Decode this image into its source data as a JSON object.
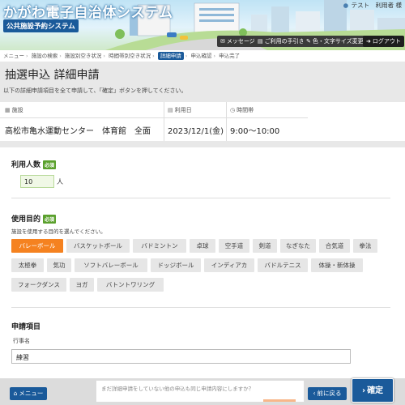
{
  "header": {
    "title": "かがわ電子自治体システム",
    "subtitle": "公共施設予約システム",
    "user_name": "テスト　利用者 様",
    "buttons": [
      {
        "icon": "message-icon",
        "label": "メッセージ"
      },
      {
        "icon": "guide-icon",
        "label": "ご利用の手引き"
      },
      {
        "icon": "paint-icon",
        "label": "色・文字サイズ変更"
      },
      {
        "icon": "logout-icon",
        "label": "ログアウト"
      }
    ]
  },
  "breadcrumb": {
    "items": [
      "メニュー",
      "施設の検索",
      "施設別空き状況",
      "時間帯別空き状況",
      "詳細申請",
      "申込確認",
      "申込完了"
    ],
    "current_index": 4
  },
  "page": {
    "title": "抽選申込 詳細申請",
    "instruction": "以下の詳細申請項目を全て申請して、「確定」ボタンを押してください。"
  },
  "facility": {
    "facility_label": "施設",
    "facility_value": "高松市亀水運動センター　体育館　全面",
    "date_label": "利用日",
    "date_value": "2023/12/1(金)",
    "time_label": "時間帯",
    "time_value": "9:00～10:00"
  },
  "form": {
    "count_title": "利用人数",
    "required_label": "必須",
    "count_value": "10",
    "count_unit": "人",
    "purpose_title": "使用目的",
    "purpose_hint": "施設を使用する目的を選んでください。",
    "purposes": [
      "バレーボール",
      "バスケットボール",
      "バドミントン",
      "卓球",
      "空手道",
      "剣道",
      "なぎなた",
      "合気道",
      "拳法",
      "太極拳",
      "気功",
      "ソフトバレーボール",
      "ドッジボール",
      "インディアカ",
      "バドルテニス",
      "体操・新体操",
      "フォークダンス",
      "ヨガ",
      "バトントワリング"
    ],
    "selected_purpose": "バレーボール",
    "application_title": "申請項目",
    "event_name_label": "行事名",
    "event_name_value": "練習"
  },
  "footer": {
    "menu_label": "メニュー",
    "back_label": "前に戻る",
    "confirm_label": "確定",
    "dialog_hint": "まだ詳細申請をしていない他の申込も同じ申請内容にしますか？"
  },
  "colors": {
    "primary": "#1a5a9a",
    "selected": "#f58220",
    "required": "#5aa02c"
  }
}
